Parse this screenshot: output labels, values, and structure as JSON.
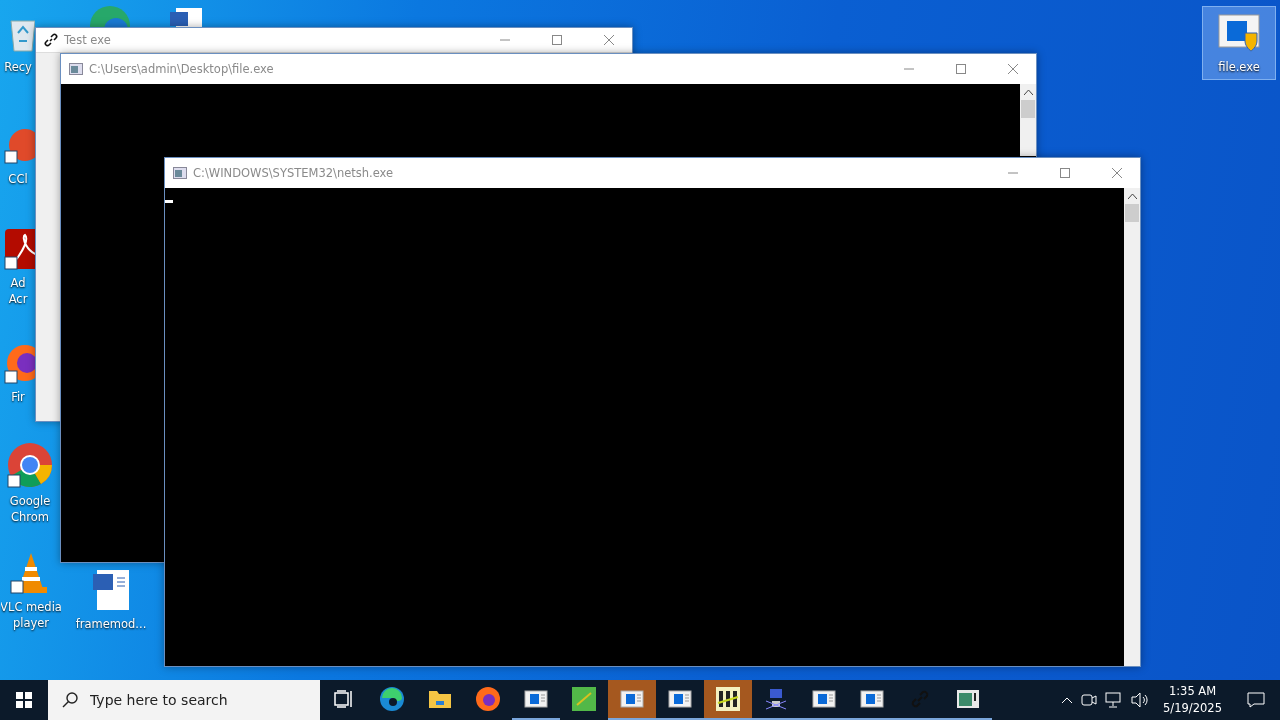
{
  "desktop_icons": [
    {
      "label": "Recy",
      "kind": "recycle"
    },
    {
      "label": "CCl",
      "kind": "ccleaner"
    },
    {
      "label": "Ad\nAcr",
      "kind": "acrobat"
    },
    {
      "label": "Fir",
      "kind": "firefox"
    },
    {
      "label": "Google\nChrom",
      "kind": "chrome"
    },
    {
      "label": "VLC media\nplayer",
      "kind": "vlc"
    },
    {
      "label": "framemod...",
      "kind": "word"
    },
    {
      "label": "file.exe",
      "kind": "exe",
      "selected": true
    }
  ],
  "windows": [
    {
      "title": "Test exe",
      "kind": "blank"
    },
    {
      "title": "C:\\Users\\admin\\Desktop\\file.exe",
      "kind": "console"
    },
    {
      "title": "C:\\WINDOWS\\SYSTEM32\\netsh.exe",
      "kind": "console"
    }
  ],
  "taskbar": {
    "search": {
      "placeholder": "Type here to search"
    },
    "apps": [
      {
        "kind": "taskview",
        "active": false,
        "running": false
      },
      {
        "kind": "edge",
        "active": false,
        "running": false
      },
      {
        "kind": "folder",
        "active": false,
        "running": false
      },
      {
        "kind": "firefox",
        "active": false,
        "running": false
      },
      {
        "kind": "app",
        "active": false,
        "running": true
      },
      {
        "kind": "bh",
        "active": false,
        "running": false
      },
      {
        "kind": "app",
        "active": true,
        "running": true
      },
      {
        "kind": "app",
        "active": false,
        "running": true
      },
      {
        "kind": "bars",
        "active": true,
        "running": true
      },
      {
        "kind": "network",
        "active": false,
        "running": true
      },
      {
        "kind": "app",
        "active": false,
        "running": true
      },
      {
        "kind": "app",
        "active": false,
        "running": true
      },
      {
        "kind": "link",
        "active": false,
        "running": true
      },
      {
        "kind": "console",
        "active": false,
        "running": true
      }
    ],
    "time": "1:35 AM",
    "date": "5/19/2025"
  }
}
